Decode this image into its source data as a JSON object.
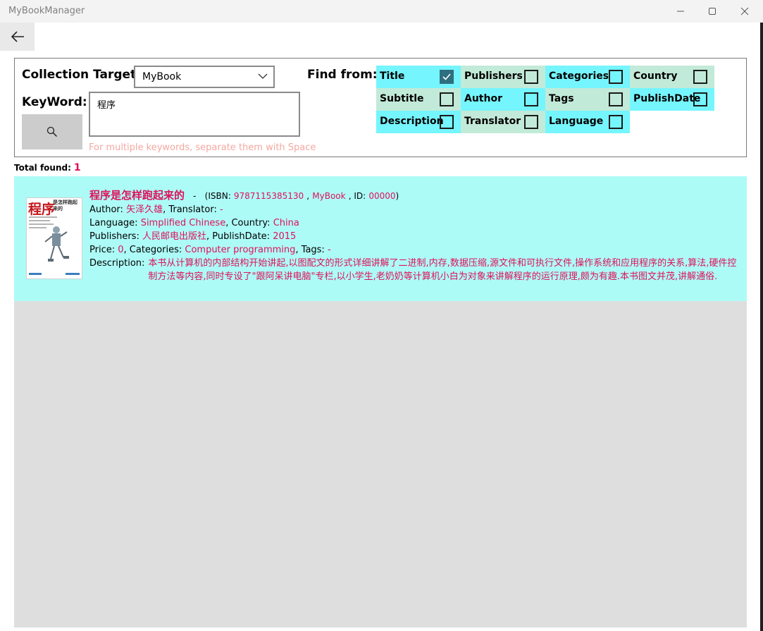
{
  "window": {
    "title": "MyBookManager"
  },
  "search": {
    "collection_label": "Collection Target:",
    "collection_value": "MyBook",
    "keyword_label": "KeyWord:",
    "keyword_value": "程序",
    "hint": "For multiple keywords, separate them with Space",
    "findfrom_label": "Find from:",
    "fields": [
      {
        "label": "Title",
        "checked": true,
        "bg": "#75f5fd"
      },
      {
        "label": "Publishers",
        "checked": false,
        "bg": "#c2ead8"
      },
      {
        "label": "Categories",
        "checked": false,
        "bg": "#75f5fd"
      },
      {
        "label": "Country",
        "checked": false,
        "bg": "#c2ead8"
      },
      {
        "label": "Subtitle",
        "checked": false,
        "bg": "#c2ead8"
      },
      {
        "label": "Author",
        "checked": false,
        "bg": "#75f5fd"
      },
      {
        "label": "Tags",
        "checked": false,
        "bg": "#c2ead8"
      },
      {
        "label": "PublishDate",
        "checked": false,
        "bg": "#75f5fd"
      },
      {
        "label": "Description",
        "checked": false,
        "bg": "#75f5fd"
      },
      {
        "label": "Translator",
        "checked": false,
        "bg": "#c2ead8"
      },
      {
        "label": "Language",
        "checked": false,
        "bg": "#75f5fd"
      }
    ]
  },
  "results": {
    "total_label": "Total found:",
    "total_count": "1",
    "books": [
      {
        "cover_big": "程序",
        "cover_small": "是怎样跑起来的",
        "title": "程序是怎样跑起来的",
        "dash": "-",
        "isbn_label": "(ISBN:",
        "isbn": "9787115385130",
        "sep": ",",
        "collection": "MyBook",
        "id_label": ", ID:",
        "id": "00000",
        "close_paren": ")",
        "author_label": "Author:",
        "author": "矢泽久雄",
        "translator_label": ", Translator:",
        "translator": "-",
        "language_label": "Language:",
        "language": "Simplified Chinese",
        "country_label": ", Country:",
        "country": "China",
        "publishers_label": "Publishers:",
        "publishers": "人民邮电出版社",
        "publishdate_label": ", PublishDate:",
        "publishdate": "2015",
        "price_label": "Price:",
        "price": "0",
        "categories_label": ", Categories:",
        "categories": "Computer programming",
        "tags_label": ",   Tags:",
        "tags": "-",
        "description_label": "Description:",
        "description": "本书从计算机的内部结构开始讲起,以图配文的形式详细讲解了二进制,内存,数据压缩,源文件和可执行文件,操作系统和应用程序的关系,算法,硬件控制方法等内容,同时专设了\"跟阿呆讲电脑\"专栏,以小学生,老奶奶等计算机小白为对象来讲解程序的运行原理,颇为有趣.本书图文并茂,讲解通俗."
      }
    ]
  },
  "icons": {
    "back": "arrow-left-icon",
    "search": "magnifier-icon",
    "combo": "chevron-down-icon",
    "minimize": "minimize-icon",
    "maximize": "maximize-icon",
    "close": "close-icon"
  }
}
